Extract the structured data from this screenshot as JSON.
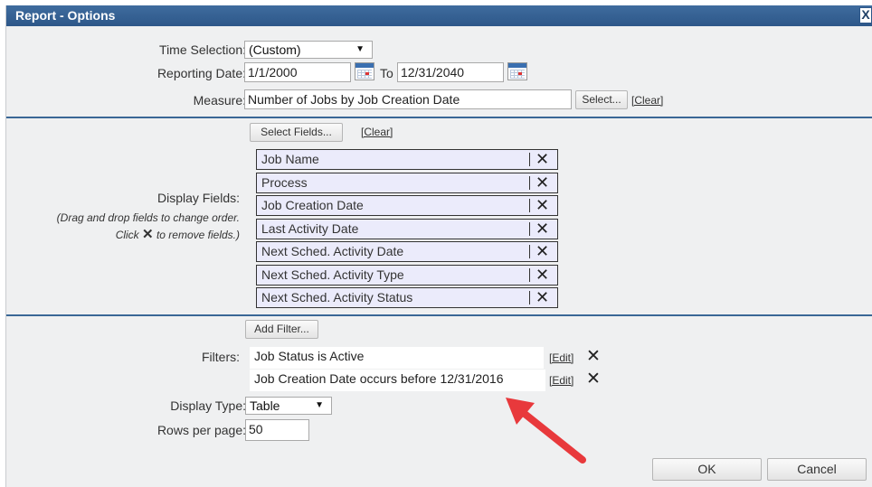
{
  "dialog": {
    "title": "Report - Options",
    "close_glyph": "X"
  },
  "time_selection": {
    "label": "Time Selection:",
    "value": "(Custom)",
    "arrow": "▼"
  },
  "reporting_date": {
    "label": "Reporting Date:",
    "from": "1/1/2000",
    "to_label": "To",
    "to": "12/31/2040"
  },
  "measure": {
    "label": "Measure:",
    "value": "Number of Jobs by Job Creation Date",
    "select_label": "Select...",
    "clear_label": "[Clear]"
  },
  "display_fields": {
    "label": "Display Fields:",
    "hint_line1": "(Drag and drop fields to change order.",
    "hint_line2_pre": "Click",
    "hint_line2_post": "to remove fields.)",
    "select_fields_label": "Select Fields...",
    "clear_label": "[Clear]",
    "remove_glyph": "✕",
    "items": [
      "Job Name",
      "Process",
      "Job Creation Date",
      "Last Activity Date",
      "Next Sched. Activity Date",
      "Next Sched. Activity Type",
      "Next Sched. Activity Status"
    ]
  },
  "filters": {
    "add_filter_label": "Add Filter...",
    "label": "Filters:",
    "edit_label": "[Edit]",
    "remove_glyph": "✕",
    "items": [
      "Job Status is Active",
      "Job Creation Date occurs before 12/31/2016"
    ]
  },
  "display_type": {
    "label": "Display Type:",
    "value": "Table",
    "arrow": "▼"
  },
  "rows_per_page": {
    "label": "Rows per page:",
    "value": "50"
  },
  "buttons": {
    "ok": "OK",
    "cancel": "Cancel"
  },
  "colors": {
    "title_bar": "#2d5789",
    "field_bg": "#ebebfb",
    "divider": "#3a6796",
    "annotation_arrow": "#e8393c"
  },
  "icons": [
    "calendar-icon",
    "close-icon",
    "remove-icon"
  ]
}
